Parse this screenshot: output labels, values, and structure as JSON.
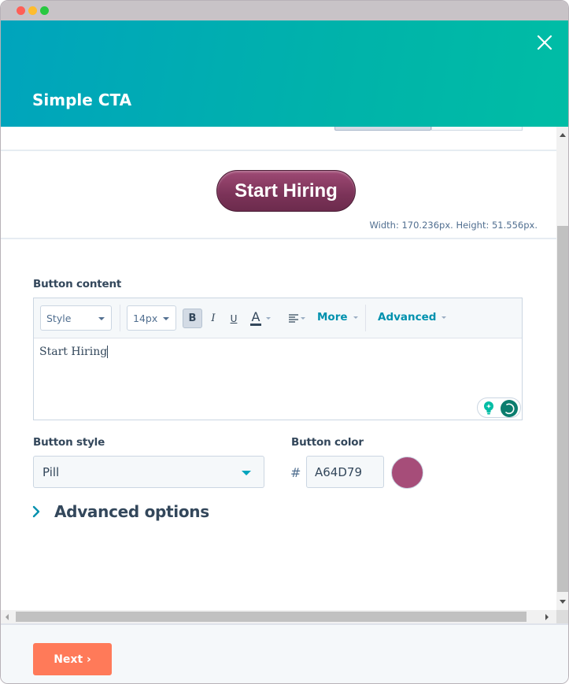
{
  "window": {
    "controls": [
      "close",
      "minimize",
      "maximize"
    ]
  },
  "header": {
    "title": "Simple CTA",
    "close_icon": "close-icon"
  },
  "preview": {
    "cta_label": "Start Hiring",
    "dimensions": "Width: 170.236px. Height: 51.556px."
  },
  "button_content": {
    "label": "Button content",
    "toolbar": {
      "style_select": "Style",
      "size_select": "14px",
      "bold": "B",
      "italic": "I",
      "underline": "U",
      "text_color": "A",
      "align_icon": "align-left-icon",
      "more": "More",
      "advanced": "Advanced"
    },
    "text": "Start Hiring"
  },
  "button_style": {
    "label": "Button style",
    "value": "Pill"
  },
  "button_color": {
    "label": "Button color",
    "hash": "#",
    "value": "A64D79",
    "swatch": "#a64d79"
  },
  "advanced_options": {
    "label": "Advanced options",
    "expanded": false
  },
  "footer": {
    "next_label": "Next ›"
  },
  "colors": {
    "accent": "#00a4bd",
    "primary_button": "#ff7a59",
    "cta": "#a64d79"
  }
}
